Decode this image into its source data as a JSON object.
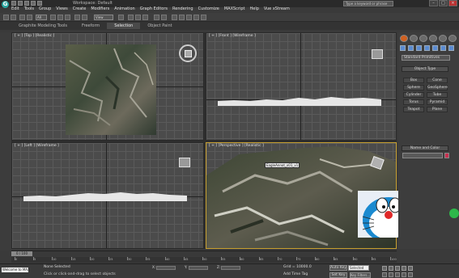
{
  "titlebar": {
    "logo": "G",
    "title": "Workspace: Default",
    "search_placeholder": "Type a keyword or phrase"
  },
  "menu": [
    "Edit",
    "Tools",
    "Group",
    "Views",
    "Create",
    "Modifiers",
    "Animation",
    "Graph Editors",
    "Rendering",
    "Customize",
    "MAXScript",
    "Help",
    "Vue xStream"
  ],
  "toolbar": {
    "filter": "All",
    "view": "View"
  },
  "ribbon_tabs": [
    {
      "label": "Graphite Modeling Tools",
      "active": false
    },
    {
      "label": "Freeform",
      "active": false
    },
    {
      "label": "Selection",
      "active": true
    },
    {
      "label": "Object Paint",
      "active": false
    }
  ],
  "viewports": {
    "top": "[ + ] [Top ] [Realistic ]",
    "front": "[ + ] [Front ] [Wireframe ]",
    "left": "[ + ] [Left ] [Wireframe ]",
    "perspective": "[ + ] [Perspective ] [Realistic ]",
    "object_label": "EagleAnnot_x01_v1"
  },
  "command_panel": {
    "primitive_type": "Standard Primitives",
    "object_type_header": "Object Type",
    "objects": [
      "Box",
      "Cone",
      "Sphere",
      "GeoSphere",
      "Cylinder",
      "Tube",
      "Torus",
      "Pyramid",
      "Teapot",
      "Plane"
    ],
    "name_color_header": "Name and Color"
  },
  "timeline": {
    "position": "0 / 100",
    "ticks": [
      "0",
      "5",
      "10",
      "15",
      "20",
      "25",
      "30",
      "35",
      "40",
      "45",
      "50",
      "55",
      "60",
      "65",
      "70",
      "75",
      "80",
      "85",
      "90",
      "95",
      "100"
    ]
  },
  "status": {
    "maxscript": "Welcome to MAX",
    "selection": "None Selected",
    "prompt": "Click or click-and-drag to select objects",
    "x_label": "X:",
    "y_label": "Y:",
    "z_label": "Z:",
    "grid": "Grid = 10000.0",
    "add_time_tag": "Add Time Tag",
    "auto_key": "Auto Key",
    "set_key": "Set Key",
    "selected_dropdown": "Selected",
    "key_filters": "Key Filters..."
  },
  "colors": {
    "active_border": "#c8a030",
    "accent": "#d06020"
  }
}
